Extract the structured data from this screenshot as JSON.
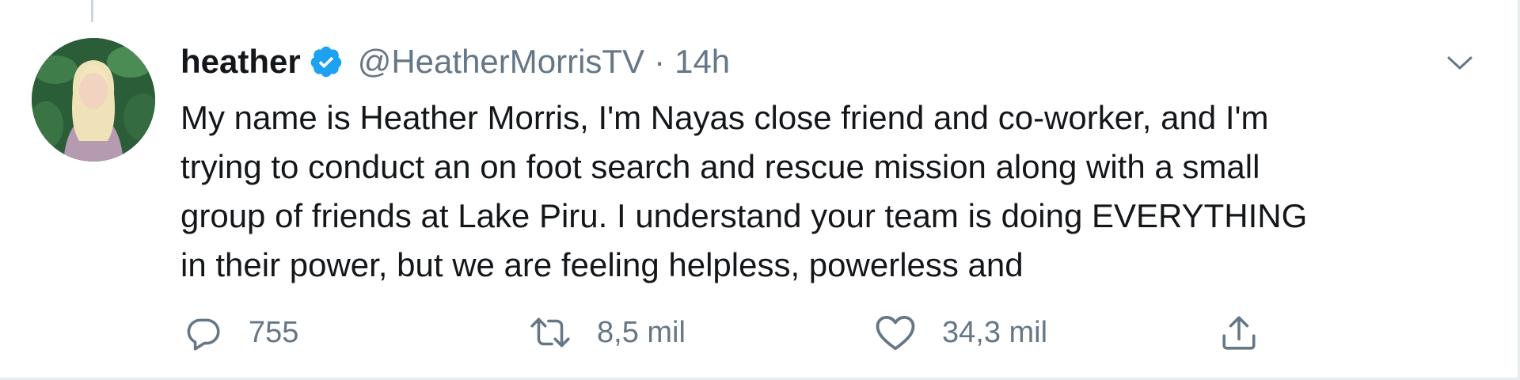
{
  "tweet": {
    "author": {
      "name": "heather",
      "handle": "@HeatherMorrisTV",
      "verified": true,
      "avatar": "profile-photo"
    },
    "separator": "·",
    "timestamp": "14h",
    "body_lines": [
      "My name is Heather Morris, I'm Nayas close friend and co-worker, and I'm",
      "trying to conduct an on foot search and rescue mission along with a small",
      "group of friends at Lake Piru. I understand your team is doing EVERYTHING",
      "in their power, but we are feeling helpless, powerless and"
    ],
    "actions": {
      "reply": {
        "icon": "reply-icon",
        "count": "755"
      },
      "retweet": {
        "icon": "retweet-icon",
        "count": "8,5 mil"
      },
      "like": {
        "icon": "heart-icon",
        "count": "34,3 mil"
      },
      "share": {
        "icon": "share-icon"
      }
    },
    "menu_icon": "chevron-down-icon"
  },
  "colors": {
    "text_primary": "#14171a",
    "text_secondary": "#657786",
    "verified_blue": "#1da1f2",
    "border": "#e6ecf0"
  }
}
